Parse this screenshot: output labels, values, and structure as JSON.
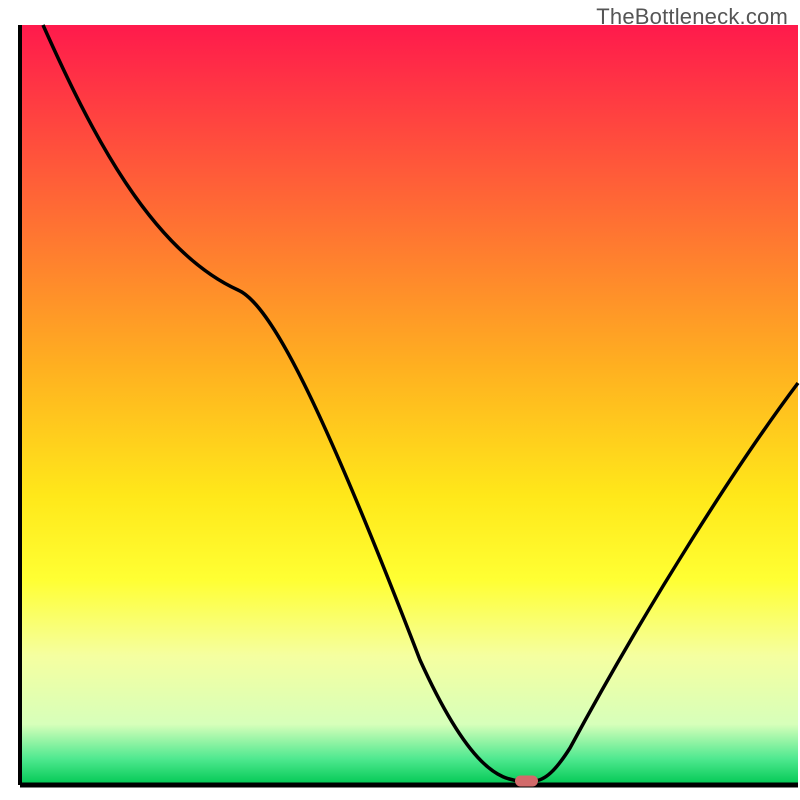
{
  "watermark": "TheBottleneck.com",
  "chart_data": {
    "type": "line",
    "title": "",
    "xlabel": "",
    "ylabel": "",
    "xlim": [
      0,
      100
    ],
    "ylim": [
      0,
      100
    ],
    "x": [
      3,
      15,
      28,
      62,
      64,
      66,
      68,
      70,
      98
    ],
    "values": [
      100,
      80,
      72,
      4,
      1,
      0.5,
      1,
      3,
      52
    ],
    "marker": {
      "x": 66,
      "y": 0.5,
      "color": "#d26a6a"
    },
    "background_gradient": {
      "stops": [
        {
          "offset": 0.0,
          "color": "#ff1a4c"
        },
        {
          "offset": 0.45,
          "color": "#ffb020"
        },
        {
          "offset": 0.62,
          "color": "#ffe81a"
        },
        {
          "offset": 0.73,
          "color": "#ffff33"
        },
        {
          "offset": 0.83,
          "color": "#f5ffa0"
        },
        {
          "offset": 0.92,
          "color": "#d7ffba"
        },
        {
          "offset": 0.965,
          "color": "#50e990"
        },
        {
          "offset": 1.0,
          "color": "#00c853"
        }
      ]
    },
    "axis_color": "#000000"
  }
}
